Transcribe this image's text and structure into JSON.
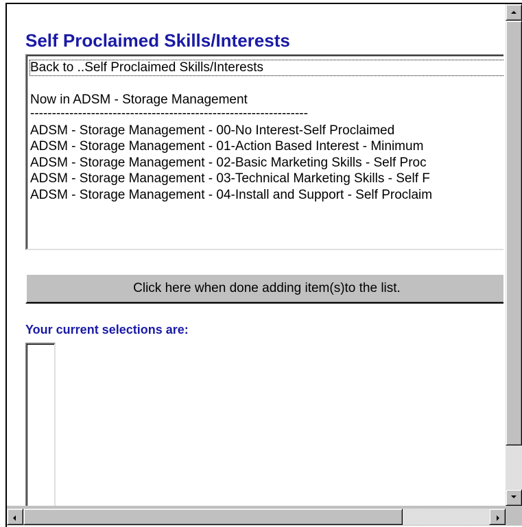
{
  "page": {
    "title": "Self Proclaimed Skills/Interests"
  },
  "listbox": {
    "items": [
      "Back to ..Self Proclaimed Skills/Interests",
      "",
      "Now in ADSM - Storage Management",
      "----------------------------------------------------------------",
      "ADSM - Storage Management - 00-No Interest-Self Proclaimed",
      "ADSM - Storage Management - 01-Action Based Interest - Minimum",
      "ADSM - Storage Management - 02-Basic Marketing Skills - Self Proc",
      "ADSM - Storage Management - 03-Technical Marketing Skills - Self F",
      "ADSM - Storage Management - 04-Install and Support - Self Proclaim"
    ]
  },
  "done_button": {
    "label": "Click here when done adding item(s)to the list."
  },
  "selections": {
    "label": "Your current selections are:"
  },
  "colors": {
    "heading": "#1a1aa6",
    "chrome": "#c0c0c0"
  }
}
